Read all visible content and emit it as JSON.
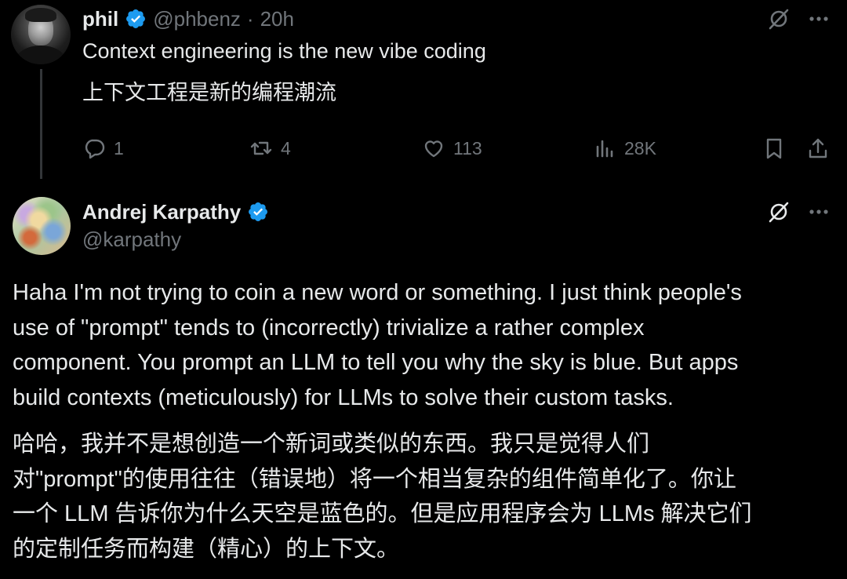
{
  "tweet1": {
    "author_name": "phil",
    "handle": "@phbenz",
    "separator": "·",
    "time": "20h",
    "text_en": "Context engineering is the new vibe coding",
    "text_cn": "上下文工程是新的编程潮流",
    "actions": {
      "replies": "1",
      "reposts": "4",
      "likes": "113",
      "views": "28K"
    }
  },
  "tweet2": {
    "author_name": "Andrej Karpathy",
    "handle": "@karpathy",
    "body_en": [
      "Haha I'm not trying to coin a new word or something. I just think people's",
      "use of \"prompt\" tends to (incorrectly) trivialize a rather complex",
      "component. You prompt an LLM to tell you why the sky is blue. But apps",
      "build contexts (meticulously) for LLMs to solve their custom tasks."
    ],
    "body_cn": [
      "哈哈，我并不是想创造一个新词或类似的东西。我只是觉得人们",
      "对\"prompt\"的使用往往（错误地）将一个相当复杂的组件简单化了。你让",
      "一个 LLM 告诉你为什么天空是蓝色的。但是应用程序会为 LLMs 解决它们",
      "的定制任务而构建（精心）的上下文。"
    ]
  },
  "colors": {
    "background": "#000000",
    "text_primary": "#e7e9ea",
    "text_secondary": "#71767b",
    "verified_blue": "#1d9bf0",
    "thread_line": "#333639"
  },
  "icons": {
    "grok": "grok-icon",
    "more": "more-icon",
    "reply": "reply-icon",
    "repost": "repost-icon",
    "like": "like-icon",
    "views": "views-icon",
    "bookmark": "bookmark-icon",
    "share": "share-icon",
    "verified": "verified-badge-icon"
  }
}
